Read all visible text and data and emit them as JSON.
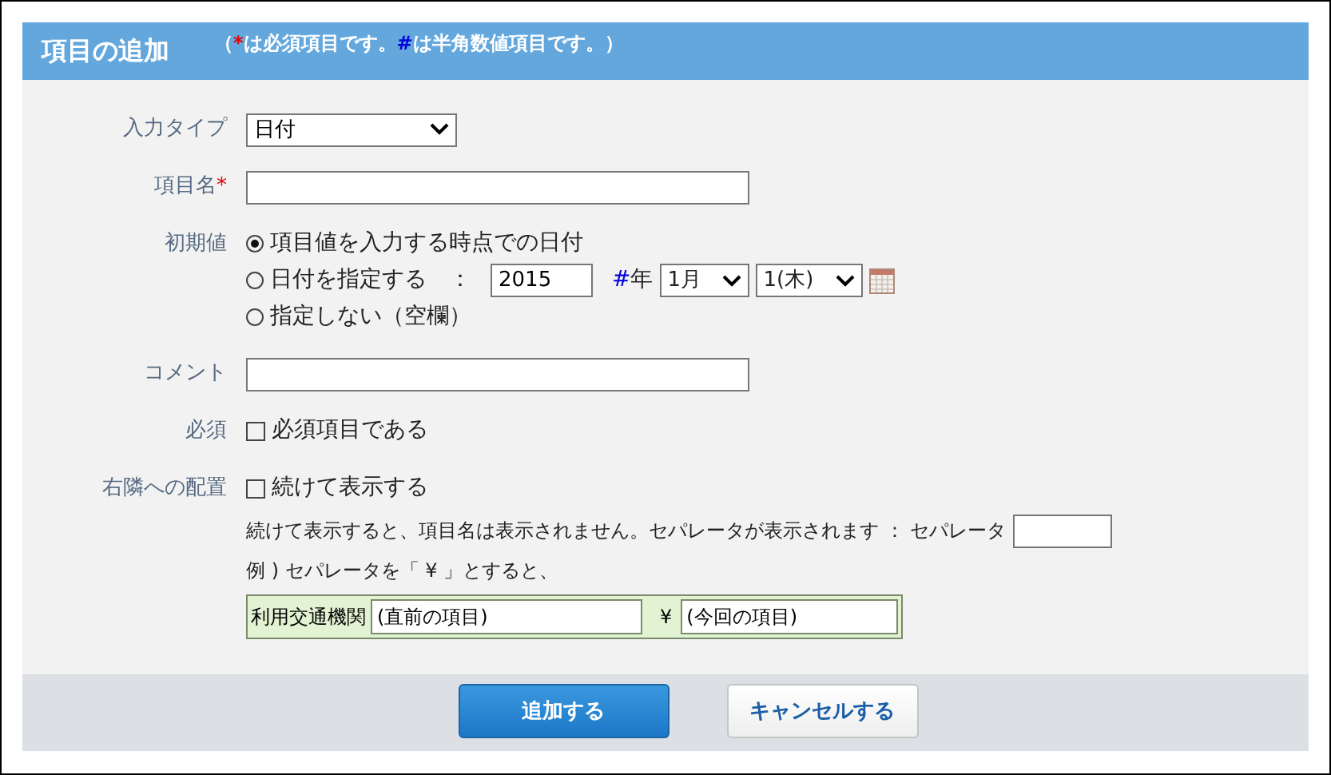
{
  "header": {
    "title": "項目の追加",
    "note": [
      {
        "kind": "text",
        "text": "（"
      },
      {
        "kind": "required",
        "text": "*"
      },
      {
        "kind": "text",
        "text": "は必須項目です。"
      },
      {
        "kind": "numeric",
        "text": "#"
      },
      {
        "kind": "text",
        "text": "は半角数値項目です。）"
      }
    ]
  },
  "input_type": {
    "label": "入力タイプ",
    "value": "日付"
  },
  "field_name": {
    "label": "項目名",
    "required_mark": "*"
  },
  "initial_value": {
    "label": "初期値",
    "options": [
      {
        "kind": "plain",
        "label": "項目値を入力する時点での日付",
        "selected": true
      },
      {
        "kind": "date",
        "label": "日付を指定する",
        "colon": "：",
        "year": "2015",
        "numeric_mark": "#",
        "year_unit": "年",
        "month": "1月",
        "day": "1(木)",
        "selected": false
      },
      {
        "kind": "plain",
        "label": "指定しない（空欄）",
        "selected": false
      }
    ]
  },
  "comment": {
    "label": "コメント"
  },
  "required": {
    "label": "必須",
    "option": "必須項目である",
    "checked": false
  },
  "placement": {
    "label": "右隣への配置",
    "option": "続けて表示する",
    "checked": false,
    "help": "続けて表示すると、項目名は表示されません。セパレータが表示されます ： セパレータ",
    "example_text": "例 ) セパレータを「 ¥ 」とすると、",
    "example": {
      "name": "利用交通機関",
      "previous": "(直前の項目)",
      "separator": "¥",
      "current": "(今回の項目)"
    }
  },
  "buttons": [
    {
      "kind": "primary",
      "label": "追加する"
    },
    {
      "kind": "secondary",
      "label": "キャンセルする"
    }
  ]
}
